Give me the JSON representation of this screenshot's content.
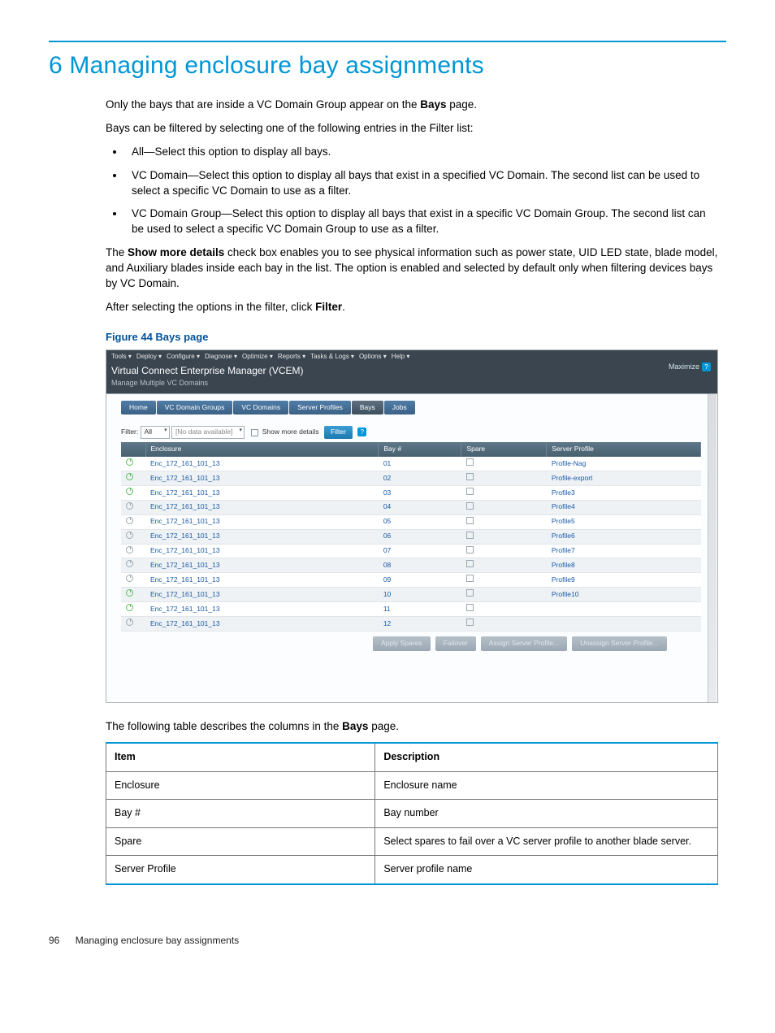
{
  "heading": "6 Managing enclosure bay assignments",
  "intro": {
    "p1a": "Only the bays that are inside a VC Domain Group appear on the ",
    "p1b": "Bays",
    "p1c": " page.",
    "p2": "Bays can be filtered by selecting one of the following entries in the Filter list:",
    "bullets": [
      "All—Select this option to display all bays.",
      "VC Domain—Select this option to display all bays that exist in a specified VC Domain. The second list can be used to select a specific VC Domain to use as a filter.",
      "VC Domain Group—Select this option to display all bays that exist in a specific VC Domain Group. The second list can be used to select a specific VC Domain Group to use as a filter."
    ],
    "p3a": "The ",
    "p3b": "Show more details",
    "p3c": " check box enables you to see physical information such as power state, UID LED state, blade model, and Auxiliary blades inside each bay in the list. The option is enabled and selected by default only when filtering devices bays by VC Domain.",
    "p4a": "After selecting the options in the filter, click ",
    "p4b": "Filter",
    "p4c": "."
  },
  "figure_title": "Figure 44 Bays page",
  "shot": {
    "menus": [
      "Tools ▾",
      "Deploy ▾",
      "Configure ▾",
      "Diagnose ▾",
      "Optimize ▾",
      "Reports ▾",
      "Tasks & Logs ▾",
      "Options ▾",
      "Help ▾"
    ],
    "title_main": "Virtual Connect Enterprise Manager (VCEM)",
    "title_sub": "Manage Multiple VC Domains",
    "maximize": "Maximize",
    "tabs": [
      "Home",
      "VC Domain Groups",
      "VC Domains",
      "Server Profiles",
      "Bays",
      "Jobs"
    ],
    "active_tab_index": 4,
    "filter": {
      "label": "Filter:",
      "sel1": "All",
      "sel2": "[No data available]",
      "show_more": "Show more details",
      "btn": "Filter"
    },
    "columns": [
      "",
      "Enclosure",
      "Bay #",
      "Spare",
      "Server Profile"
    ],
    "rows": [
      {
        "power": "on",
        "enclosure": "Enc_172_161_101_13",
        "bay": "01",
        "profile": "Profile-Nag"
      },
      {
        "power": "on",
        "enclosure": "Enc_172_161_101_13",
        "bay": "02",
        "profile": "Profile-export"
      },
      {
        "power": "on",
        "enclosure": "Enc_172_161_101_13",
        "bay": "03",
        "profile": "Profile3"
      },
      {
        "power": "off",
        "enclosure": "Enc_172_161_101_13",
        "bay": "04",
        "profile": "Profile4"
      },
      {
        "power": "off",
        "enclosure": "Enc_172_161_101_13",
        "bay": "05",
        "profile": "Profile5"
      },
      {
        "power": "off",
        "enclosure": "Enc_172_161_101_13",
        "bay": "06",
        "profile": "Profile6"
      },
      {
        "power": "off",
        "enclosure": "Enc_172_161_101_13",
        "bay": "07",
        "profile": "Profile7"
      },
      {
        "power": "off",
        "enclosure": "Enc_172_161_101_13",
        "bay": "08",
        "profile": "Profile8"
      },
      {
        "power": "off",
        "enclosure": "Enc_172_161_101_13",
        "bay": "09",
        "profile": "Profile9"
      },
      {
        "power": "on",
        "enclosure": "Enc_172_161_101_13",
        "bay": "10",
        "profile": "Profile10"
      },
      {
        "power": "on",
        "enclosure": "Enc_172_161_101_13",
        "bay": "11",
        "profile": ""
      },
      {
        "power": "off",
        "enclosure": "Enc_172_161_101_13",
        "bay": "12",
        "profile": ""
      }
    ],
    "actions": [
      "Apply Spares",
      "Failover",
      "Assign Server Profile...",
      "Unassign Server Profile..."
    ]
  },
  "table_intro_a": "The following table describes the columns in the ",
  "table_intro_b": "Bays",
  "table_intro_c": " page.",
  "cols_table": {
    "headers": [
      "Item",
      "Description"
    ],
    "rows": [
      [
        "Enclosure",
        "Enclosure name"
      ],
      [
        "Bay #",
        "Bay number"
      ],
      [
        "Spare",
        "Select spares to fail over a VC server profile to another blade server."
      ],
      [
        "Server Profile",
        "Server profile name"
      ]
    ]
  },
  "footer": {
    "page": "96",
    "title": "Managing enclosure bay assignments"
  }
}
